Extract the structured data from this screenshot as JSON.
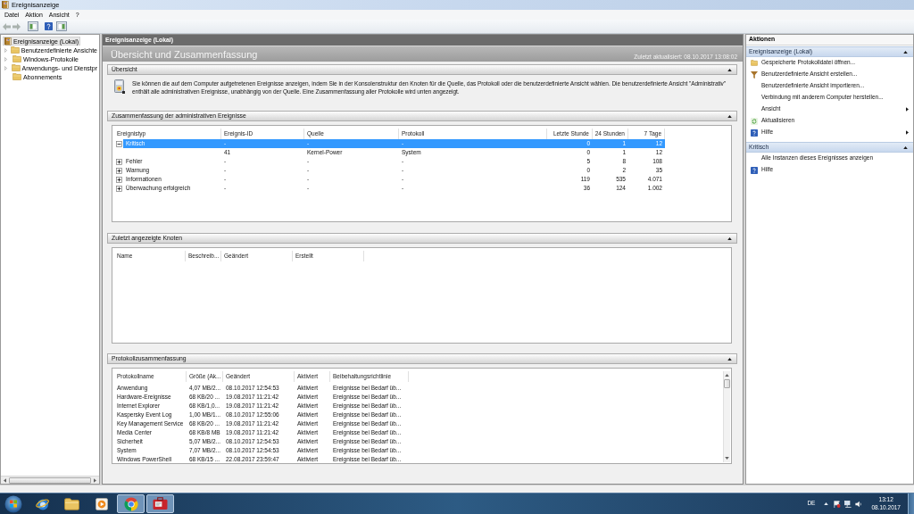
{
  "window": {
    "title": "Ereignisanzeige"
  },
  "menu": [
    {
      "label": "Datei"
    },
    {
      "label": "Aktion"
    },
    {
      "label": "Ansicht"
    },
    {
      "label": "?"
    }
  ],
  "toolbar": [
    {
      "disabled": true
    },
    {
      "disabled": true
    },
    {
      "disabled": false
    },
    {
      "disabled": false
    },
    {
      "disabled": false
    }
  ],
  "tree": [
    {
      "label": "Ereignisanzeige (Lokal)",
      "selected": true,
      "expandable": false,
      "children": [
        {
          "label": "Benutzerdefinierte Ansichte",
          "selected": false,
          "expandable": true
        },
        {
          "label": "Windows-Protokolle",
          "selected": false,
          "expandable": true
        },
        {
          "label": "Anwendungs- und Dienstpr",
          "selected": false,
          "expandable": true
        },
        {
          "label": "Abonnements",
          "selected": false,
          "expandable": false
        }
      ]
    }
  ],
  "console": {
    "header": "Ereignisanzeige (Lokal)",
    "title": "Übersicht und Zusammenfassung",
    "updated": "Zuletzt aktualisiert: 08.10.2017 13:08:02"
  },
  "sections": [
    {
      "kind": "text",
      "title": "Übersicht",
      "expanded": true,
      "text": "Sie können die auf dem Computer aufgetretenen Ereignisse anzeigen, indem Sie in der Konsolenstruktur den Knoten für die Quelle, das Protokoll oder die benutzerdefinierte Ansicht wählen. Die benutzerdefinierte Ansicht \"Administrativ\" enthält alle administrativen Ereignisse, unabhängig von der Quelle. Eine Zusammenfassung aller Protokolle wird unten angezeigt."
    },
    {
      "kind": "events",
      "title": "Zusammenfassung der administrativen Ereignisse",
      "expanded": true,
      "columns": [
        "Ereignistyp",
        "Ereignis-ID",
        "Quelle",
        "Protokoll",
        "Letzte Stunde",
        "24 Stunden",
        "7 Tage"
      ],
      "rows": [
        {
          "selected": true,
          "expanded": true,
          "cells": [
            "Kritisch",
            "-",
            "-",
            "-",
            "0",
            "1",
            "12"
          ],
          "children": [
            {
              "selected": false,
              "cells": [
                "",
                "41",
                "Kernel-Power",
                "System",
                "0",
                "1",
                "12"
              ]
            }
          ]
        },
        {
          "selected": false,
          "expanded": false,
          "cells": [
            "Fehler",
            "-",
            "-",
            "-",
            "5",
            "8",
            "108"
          ]
        },
        {
          "selected": false,
          "expanded": false,
          "cells": [
            "Warnung",
            "-",
            "-",
            "-",
            "0",
            "2",
            "35"
          ]
        },
        {
          "selected": false,
          "expanded": false,
          "cells": [
            "Informationen",
            "-",
            "-",
            "-",
            "119",
            "535",
            "4.071"
          ]
        },
        {
          "selected": false,
          "expanded": false,
          "cells": [
            "Überwachung erfolgreich",
            "-",
            "-",
            "-",
            "36",
            "124",
            "1.002"
          ]
        }
      ]
    },
    {
      "kind": "table",
      "title": "Zuletzt angezeigte Knoten",
      "expanded": true,
      "columns": [
        "Name",
        "Beschreib...",
        "Geändert",
        "Erstellt"
      ]
    },
    {
      "kind": "table",
      "title": "Protokollzusammenfassung",
      "expanded": true,
      "columns": [
        "Protokollname",
        "Größe (Ak...",
        "Geändert",
        "Aktiviert",
        "Beibehaltungsrichtlinie"
      ],
      "rows": [
        [
          "Anwendung",
          "4,07 MB/2...",
          "08.10.2017 12:54:53",
          "Aktiviert",
          "Ereignisse bei Bedarf üb..."
        ],
        [
          "Hardware-Ereignisse",
          "68 KB/20 ...",
          "19.08.2017 11:21:42",
          "Aktiviert",
          "Ereignisse bei Bedarf üb..."
        ],
        [
          "Internet Explorer",
          "68 KB/1,0...",
          "19.08.2017 11:21:42",
          "Aktiviert",
          "Ereignisse bei Bedarf üb..."
        ],
        [
          "Kaspersky Event Log",
          "1,00 MB/1...",
          "08.10.2017 12:55:06",
          "Aktiviert",
          "Ereignisse bei Bedarf üb..."
        ],
        [
          "Key Management Service",
          "68 KB/20 ...",
          "19.08.2017 11:21:42",
          "Aktiviert",
          "Ereignisse bei Bedarf üb..."
        ],
        [
          "Media Center",
          "68 KB/8 MB",
          "19.08.2017 11:21:42",
          "Aktiviert",
          "Ereignisse bei Bedarf üb..."
        ],
        [
          "Sicherheit",
          "5,07 MB/2...",
          "08.10.2017 12:54:53",
          "Aktiviert",
          "Ereignisse bei Bedarf üb..."
        ],
        [
          "System",
          "7,07 MB/2...",
          "08.10.2017 12:54:53",
          "Aktiviert",
          "Ereignisse bei Bedarf üb..."
        ],
        [
          "Windows PowerShell",
          "68 KB/15 ...",
          "22.08.2017 23:59:47",
          "Aktiviert",
          "Ereignisse bei Bedarf üb..."
        ]
      ]
    }
  ],
  "actions": {
    "title": "Aktionen",
    "groups": [
      {
        "title": "Ereignisanzeige (Lokal)",
        "expanded": true,
        "items": [
          {
            "label": "Gespeicherte Protokolldatei öffnen...",
            "submenu": false
          },
          {
            "label": "Benutzerdefinierte Ansicht erstellen...",
            "submenu": false
          },
          {
            "label": "Benutzerdefinierte Ansicht importieren...",
            "submenu": false
          },
          {
            "label": "Verbindung mit anderem Computer herstellen...",
            "submenu": false
          },
          {
            "label": "Ansicht",
            "submenu": true
          },
          {
            "label": "Aktualisieren",
            "submenu": false
          },
          {
            "label": "Hilfe",
            "submenu": true
          }
        ]
      },
      {
        "title": "Kritisch",
        "expanded": true,
        "items": [
          {
            "label": "Alle Instanzen dieses Ereignisses anzeigen",
            "submenu": false
          },
          {
            "label": "Hilfe",
            "submenu": false
          }
        ]
      }
    ]
  },
  "taskbar": {
    "apps": [
      {
        "running": false
      },
      {
        "running": false
      },
      {
        "running": false
      },
      {
        "running": true
      },
      {
        "running": true
      }
    ],
    "language": "DE",
    "time": "13:12",
    "date": "08.10.2017"
  }
}
